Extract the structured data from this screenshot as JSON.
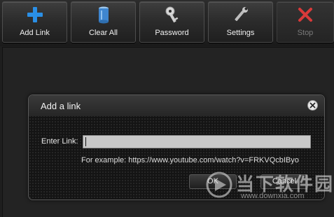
{
  "toolbar": {
    "buttons": [
      {
        "id": "add-link",
        "label": "Add Link",
        "icon": "plus-icon",
        "enabled": true
      },
      {
        "id": "clear-all",
        "label": "Clear All",
        "icon": "trash-can-icon",
        "enabled": true
      },
      {
        "id": "password",
        "label": "Password",
        "icon": "key-icon",
        "enabled": true
      },
      {
        "id": "settings",
        "label": "Settings",
        "icon": "wrench-icon",
        "enabled": true
      },
      {
        "id": "stop",
        "label": "Stop",
        "icon": "x-icon",
        "enabled": false
      }
    ]
  },
  "dialog": {
    "title": "Add a link",
    "close_icon": "close-icon",
    "link_label": "Enter Link:",
    "link_value": "",
    "example_text": "For example: https://www.youtube.com/watch?v=FRKVQcbIByo",
    "ok_label": "OK",
    "cancel_label": "Cancel"
  },
  "watermark": {
    "text": "当下软件园",
    "url": "www.downxia.com"
  },
  "colors": {
    "plus_blue": "#2a8fe6",
    "stop_red": "#d83a3a",
    "background": "#1e1e1e"
  }
}
